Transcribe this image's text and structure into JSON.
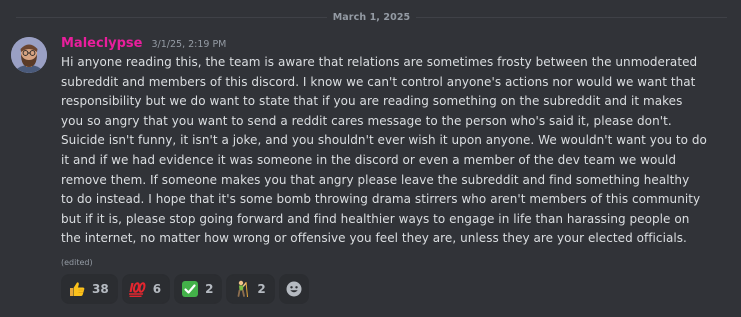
{
  "divider": {
    "date": "March 1, 2025"
  },
  "message": {
    "author": "Maleclypse",
    "author_color": "#e91e9c",
    "timestamp": "3/1/25, 2:19 PM",
    "lines": [
      "Hi anyone reading this, the team is aware that relations are sometimes frosty between the unmoderated",
      "subreddit and members of this discord.  I know we can't control anyone's actions nor would we want that",
      "responsibility but we do want to state that if you are reading something on the subreddit and it makes",
      "you so angry that you want to send a reddit cares message to the person who's said it, please don't.",
      "Suicide isn't funny, it isn't a joke, and you shouldn't ever wish it upon anyone. We wouldn't want you to do",
      "it and if we had evidence it was someone in the discord or even a member of the dev team we would",
      "remove them.  If someone makes you that angry please leave the subreddit and find something healthy",
      "to do instead. I hope that it's some bomb throwing drama stirrers who aren't members of this community",
      "but if it is, please stop going forward and find healthier ways to engage in life than harassing people on",
      "the internet, no matter how wrong or offensive you feel they are, unless they are your elected officials."
    ],
    "edited_label": "(edited)"
  },
  "reactions": [
    {
      "emoji": "thumbs-up",
      "count": "38"
    },
    {
      "emoji": "hundred-points",
      "count": "6"
    },
    {
      "emoji": "check-mark-button",
      "count": "2"
    },
    {
      "emoji": "person-climbing",
      "count": "2"
    }
  ],
  "add_reaction": {
    "icon": "smiley-add-reaction-icon"
  },
  "colors": {
    "background": "#313338",
    "text": "#dbdee1",
    "muted": "#949ba4",
    "reaction_bg": "#2b2d31"
  }
}
